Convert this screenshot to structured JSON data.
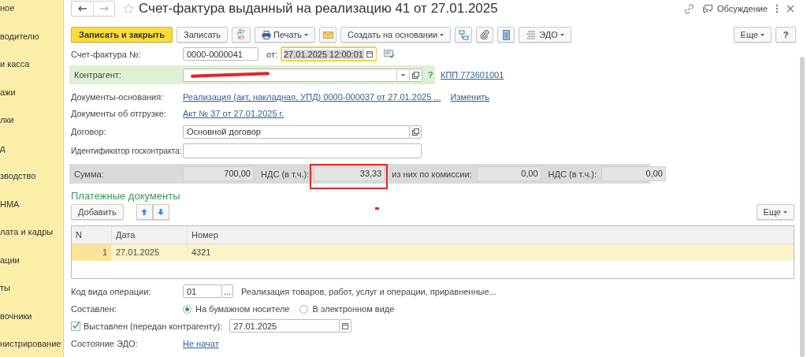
{
  "sidebar": {
    "items": [
      {
        "label": "ное"
      },
      {
        "label": "водителю"
      },
      {
        "label": "и касса"
      },
      {
        "label": "ажи"
      },
      {
        "label": "лки"
      },
      {
        "label": "д"
      },
      {
        "label": "зводство"
      },
      {
        "label": "НМА"
      },
      {
        "label": "лата и кадры"
      },
      {
        "label": "ации"
      },
      {
        "label": "ты"
      },
      {
        "label": "вочники"
      },
      {
        "label": "нистрирование"
      }
    ]
  },
  "header": {
    "title": "Счет-фактура выданный на реализацию 41 от 27.01.2025",
    "discussion": "Обсуждение"
  },
  "toolbar": {
    "save_close": "Записать и закрыть",
    "save": "Записать",
    "dtkt": [
      "Дт",
      "Кт"
    ],
    "print": "Печать",
    "create_based": "Создать на основании",
    "edo": "ЭДО",
    "more": "Еще",
    "help": "?"
  },
  "invoice": {
    "label": "Счет-фактура №:",
    "number": "0000-0000041",
    "date_label": "от:",
    "date": "27.01.2025 12:00:01"
  },
  "counterparty": {
    "label": "Контрагент:",
    "help": "?",
    "kpp": "КПП 773601001"
  },
  "base_docs": {
    "label": "Документы-основания:",
    "link": "Реализация (акт, накладная, УПД) 0000-000037 от 27.01.2025 ...",
    "change": "Изменить"
  },
  "shipment_docs": {
    "label": "Документы об отгрузке:",
    "link": "Акт № 37 от 27.01.2025 г."
  },
  "contract": {
    "label": "Договор:",
    "value": "Основной договор"
  },
  "gov_contract": {
    "label": "Идентификатор госконтракта:"
  },
  "totals": [
    {
      "label": "Сумма:",
      "value": "700,00",
      "highlighted": false
    },
    {
      "label": "НДС (в т.ч.):",
      "value": "33,33",
      "highlighted": true
    },
    {
      "label": "из них по комиссии:",
      "value": "0,00",
      "highlighted": false
    },
    {
      "label": "НДС (в т.ч.):",
      "value": "0,00",
      "highlighted": false
    }
  ],
  "payments": {
    "title": "Платежные документы",
    "add": "Добавить",
    "more": "Еще",
    "columns": [
      "N",
      "Дата",
      "Номер"
    ],
    "rows": [
      {
        "cells": [
          "1",
          "27.01.2025",
          "4321"
        ],
        "selected": true
      }
    ]
  },
  "operation_code": {
    "label": "Код вида операции:",
    "value": "01",
    "button": "...",
    "description": "Реализация товаров, работ, услуг и операции, приравненные..."
  },
  "composed": {
    "label": "Составлен:",
    "options": [
      {
        "label": "На бумажном носителе",
        "selected": true
      },
      {
        "label": "В электронном виде",
        "selected": false
      }
    ]
  },
  "issued": {
    "checked": true,
    "label": "Выставлен (передан контрагенту):",
    "date": "27.01.2025"
  },
  "edo_state": {
    "label": "Состояние ЭДО:",
    "link": "Не начат"
  }
}
